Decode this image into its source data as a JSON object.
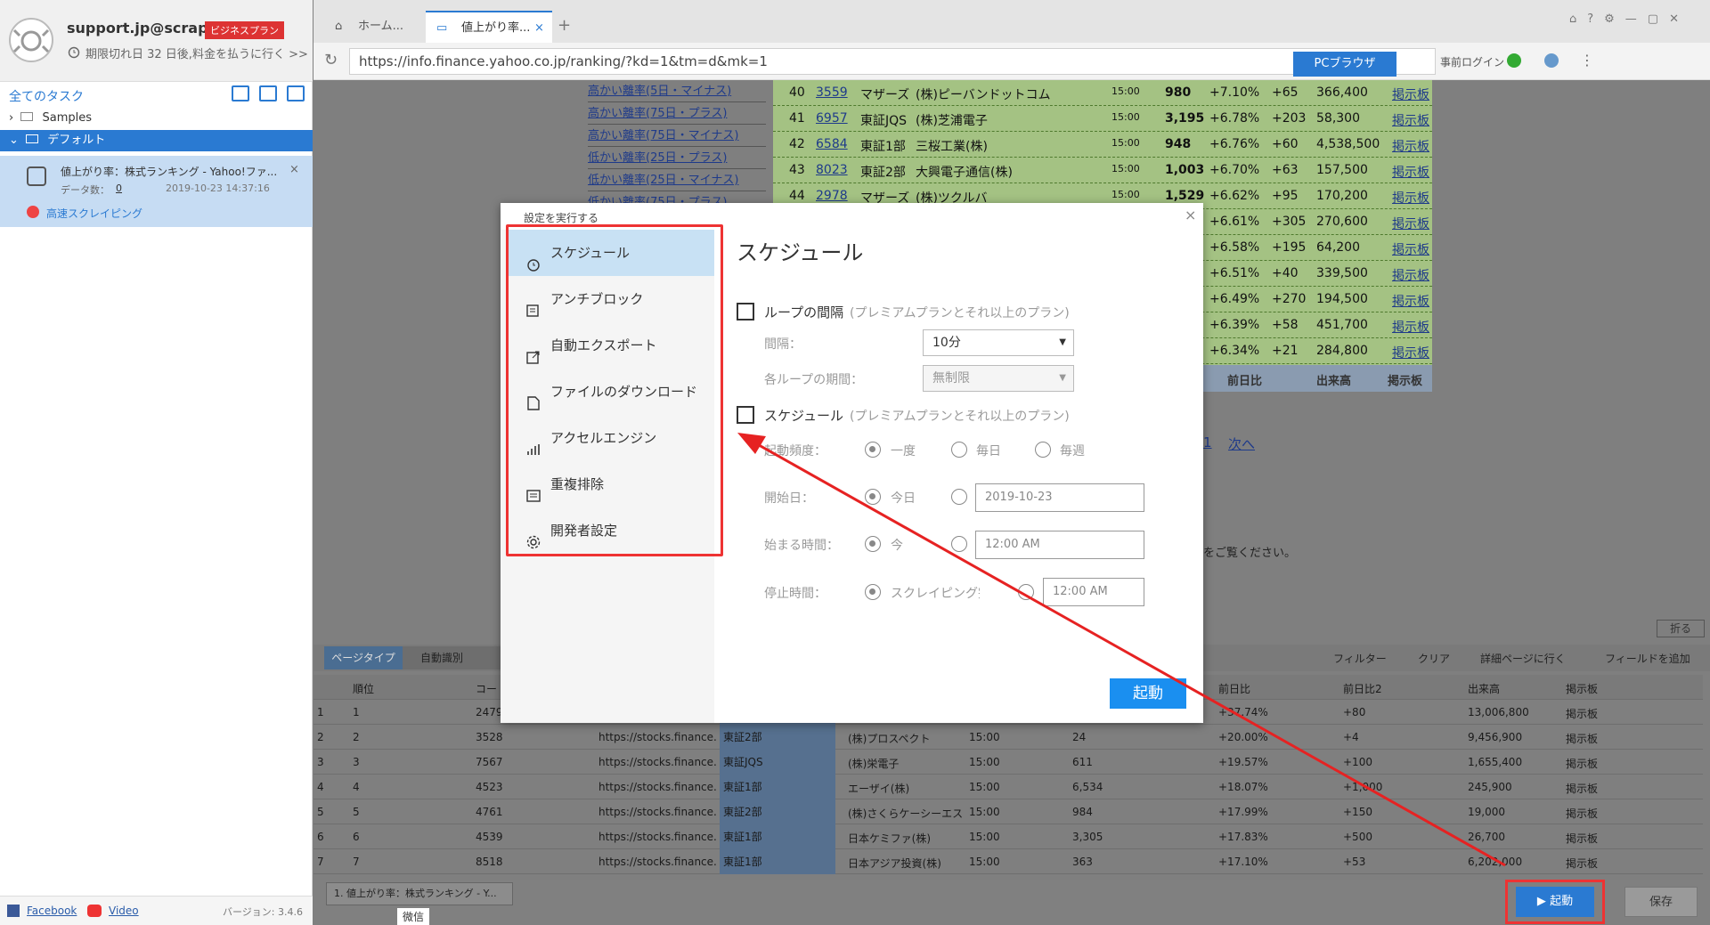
{
  "sidebar": {
    "user": "support.jp@scrap...",
    "plan": "ビジネスプラン",
    "expire": "期限切れ日 32 日後,料金を払うに行く >>",
    "all_tasks": "全てのタスク",
    "folders": [
      "Samples",
      "デフォルト"
    ],
    "task": {
      "title": "値上がり率：株式ランキング - Yahoo!ファ...",
      "data_count_label": "データ数：",
      "data_count": "0",
      "date": "2019-10-23 14:37:16",
      "mode": "高速スクレイピング"
    },
    "footer": {
      "facebook": "Facebook",
      "video": "Video",
      "version": "バージョン: 3.4.6",
      "wechat": "微信"
    }
  },
  "browser": {
    "tabs": [
      "ホーム...",
      "値上がり率..."
    ],
    "url": "https://info.finance.yahoo.co.jp/ranking/?kd=1&tm=d&mk=1",
    "prelogin": "事前ログイン",
    "pc_browser": "PCブラウザ"
  },
  "web": {
    "left_links": [
      "高かい離率(5日・マイナス)",
      "高かい離率(75日・プラス)",
      "高かい離率(75日・マイナス)",
      "低かい離率(25日・プラス)",
      "低かい離率(25日・マイナス)",
      "低かい離率(75日・プラス)"
    ],
    "rows": [
      [
        "40",
        "3559",
        "マザーズ",
        "(株)ピーバンドットコム",
        "15:00",
        "980",
        "+7.10%",
        "+65",
        "366,400",
        "掲示板"
      ],
      [
        "41",
        "6957",
        "東証JQS",
        "(株)芝浦電子",
        "15:00",
        "3,195",
        "+6.78%",
        "+203",
        "58,300",
        "掲示板"
      ],
      [
        "42",
        "6584",
        "東証1部",
        "三桜工業(株)",
        "15:00",
        "948",
        "+6.76%",
        "+60",
        "4,538,500",
        "掲示板"
      ],
      [
        "43",
        "8023",
        "東証2部",
        "大興電子通信(株)",
        "15:00",
        "1,003",
        "+6.70%",
        "+63",
        "157,500",
        "掲示板"
      ],
      [
        "44",
        "2978",
        "マザーズ",
        "(株)ツクルバ",
        "15:00",
        "1,529",
        "+6.62%",
        "+95",
        "170,200",
        "掲示板"
      ],
      [
        "",
        "",
        "",
        "",
        "",
        "",
        "+6.61%",
        "+305",
        "270,600",
        "掲示板"
      ],
      [
        "",
        "",
        "",
        "",
        "",
        "",
        "+6.58%",
        "+195",
        "64,200",
        "掲示板"
      ],
      [
        "",
        "",
        "",
        "",
        "",
        "",
        "+6.51%",
        "+40",
        "339,500",
        "掲示板"
      ],
      [
        "",
        "",
        "",
        "",
        "",
        "",
        "+6.49%",
        "+270",
        "194,500",
        "掲示板"
      ],
      [
        "",
        "",
        "",
        "",
        "",
        "",
        "+6.39%",
        "+58",
        "451,700",
        "掲示板"
      ],
      [
        "",
        "",
        "",
        "",
        "",
        "",
        "+6.34%",
        "+21",
        "284,800",
        "掲示板"
      ]
    ],
    "footer_headers": [
      "前日比",
      "出来高",
      "掲示板"
    ],
    "pager_next": "次へ",
    "pager_num": "1",
    "notice": "をご覧ください。",
    "fold": "折る"
  },
  "data_panel": {
    "page_type": "ページタイプ",
    "auto": "自動識別",
    "actions": [
      "フィルター",
      "クリア",
      "詳細ページに行く",
      "フィールドを追加"
    ],
    "headers": [
      "順位",
      "コー",
      "",
      "",
      "",
      "",
      "",
      "前日比",
      "前日比2",
      "出来高",
      "掲示板"
    ],
    "rows": [
      [
        "1",
        "1",
        "2479",
        "",
        "",
        "",
        "",
        "",
        "+37.74%",
        "+80",
        "13,006,800",
        "掲示板"
      ],
      [
        "2",
        "2",
        "3528",
        "https://stocks.finance...",
        "東証2部",
        "(株)プロスペクト",
        "15:00",
        "24",
        "+20.00%",
        "+4",
        "9,456,900",
        "掲示板"
      ],
      [
        "3",
        "3",
        "7567",
        "https://stocks.finance...",
        "東証JQS",
        "(株)栄電子",
        "15:00",
        "611",
        "+19.57%",
        "+100",
        "1,655,400",
        "掲示板"
      ],
      [
        "4",
        "4",
        "4523",
        "https://stocks.finance...",
        "東証1部",
        "エーザイ(株)",
        "15:00",
        "6,534",
        "+18.07%",
        "+1,000",
        "245,900",
        "掲示板"
      ],
      [
        "5",
        "5",
        "4761",
        "https://stocks.finance...",
        "東証2部",
        "(株)さくらケーシーエス",
        "15:00",
        "984",
        "+17.99%",
        "+150",
        "19,000",
        "掲示板"
      ],
      [
        "6",
        "6",
        "4539",
        "https://stocks.finance...",
        "東証1部",
        "日本ケミファ(株)",
        "15:00",
        "3,305",
        "+17.83%",
        "+500",
        "26,700",
        "掲示板"
      ],
      [
        "7",
        "7",
        "8518",
        "https://stocks.finance...",
        "東証1部",
        "日本アジア投資(株)",
        "15:00",
        "363",
        "+17.10%",
        "+53",
        "6,202,000",
        "掲示板"
      ]
    ],
    "task_tab": "1. 値上がり率：株式ランキング - Y..."
  },
  "modal": {
    "title": "設定を実行する",
    "menu": [
      "スケジュール",
      "アンチブロック",
      "自動エクスポート",
      "ファイルのダウンロード",
      "アクセルエンジン",
      "重複排除",
      "開発者設定"
    ],
    "heading": "スケジュール",
    "loop_label": "ループの間隔",
    "loop_premium": "(プレミアムプランとそれ以上のプラン)",
    "interval_label": "間隔：",
    "interval_value": "10分",
    "period_label": "各ループの期間：",
    "period_value": "無制限",
    "schedule_label": "スケジュール",
    "schedule_premium": "(プレミアムプランとそれ以上のプラン)",
    "freq_label": "起動頻度：",
    "freq_options": [
      "一度",
      "毎日",
      "毎週"
    ],
    "start_date_label": "開始日：",
    "today": "今日",
    "start_date_value": "2019-10-23",
    "start_time_label": "始まる時間：",
    "now": "今",
    "start_time_value": "12:00 AM",
    "stop_label": "停止時間：",
    "stop_option": "スクレイピング完了",
    "stop_time_value": "12:00 AM",
    "start_button": "起動"
  },
  "actions": {
    "start": "起動",
    "save": "保存"
  }
}
